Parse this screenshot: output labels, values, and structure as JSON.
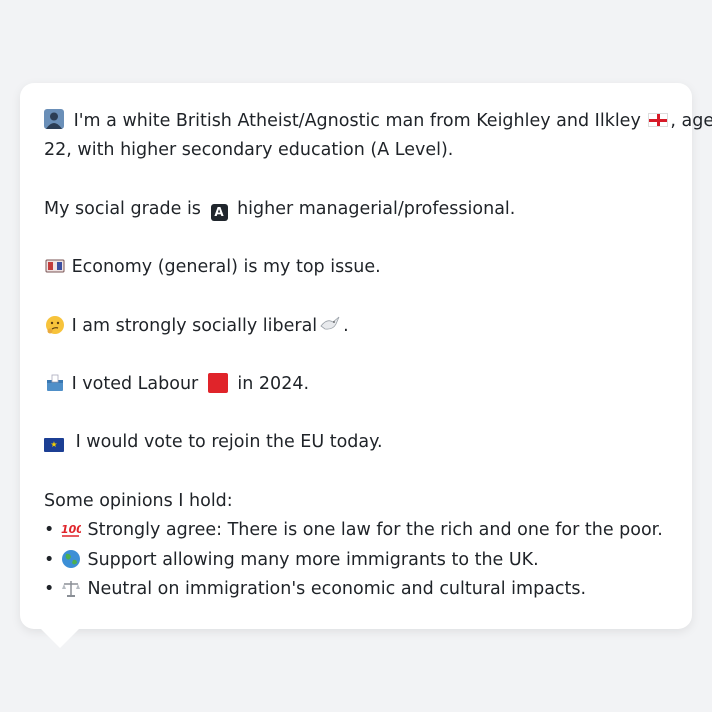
{
  "message": {
    "intro_line1": "I'm a white British Atheist/Agnostic man from Keighley and Ilkley",
    "intro_line1_end": ", aged",
    "intro_line2": "22, with higher secondary education (A Level).",
    "social_grade_prefix": "My social grade is",
    "social_grade_badge": "A",
    "social_grade_suffix": "higher managerial/professional.",
    "top_issue": "Economy (general) is my top issue.",
    "social_view": "I am strongly socially liberal",
    "social_view_end": ".",
    "vote_prefix": "I voted Labour",
    "vote_suffix": "in 2024.",
    "eu_view": "I would vote to rejoin the EU today.",
    "opinions_heading": "Some opinions I hold:",
    "opinions": [
      "Strongly agree: There is one law for the rich and one for the poor.",
      "Support allowing many more immigrants to the UK.",
      "Neutral on immigration's economic and cultural impacts."
    ]
  },
  "icons": {
    "person": "person-silhouette-icon",
    "england_flag": "england-flag-icon",
    "grade_badge": "a-button-icon",
    "money": "money-bag-icon",
    "thinking": "thinking-face-icon",
    "dove": "dove-icon",
    "ballot": "ballot-box-icon",
    "labour_color": "#e0242a",
    "eu_flag": "eu-flag-icon",
    "hundred": "hundred-points-icon",
    "globe": "globe-icon",
    "scales": "balance-scale-icon"
  }
}
